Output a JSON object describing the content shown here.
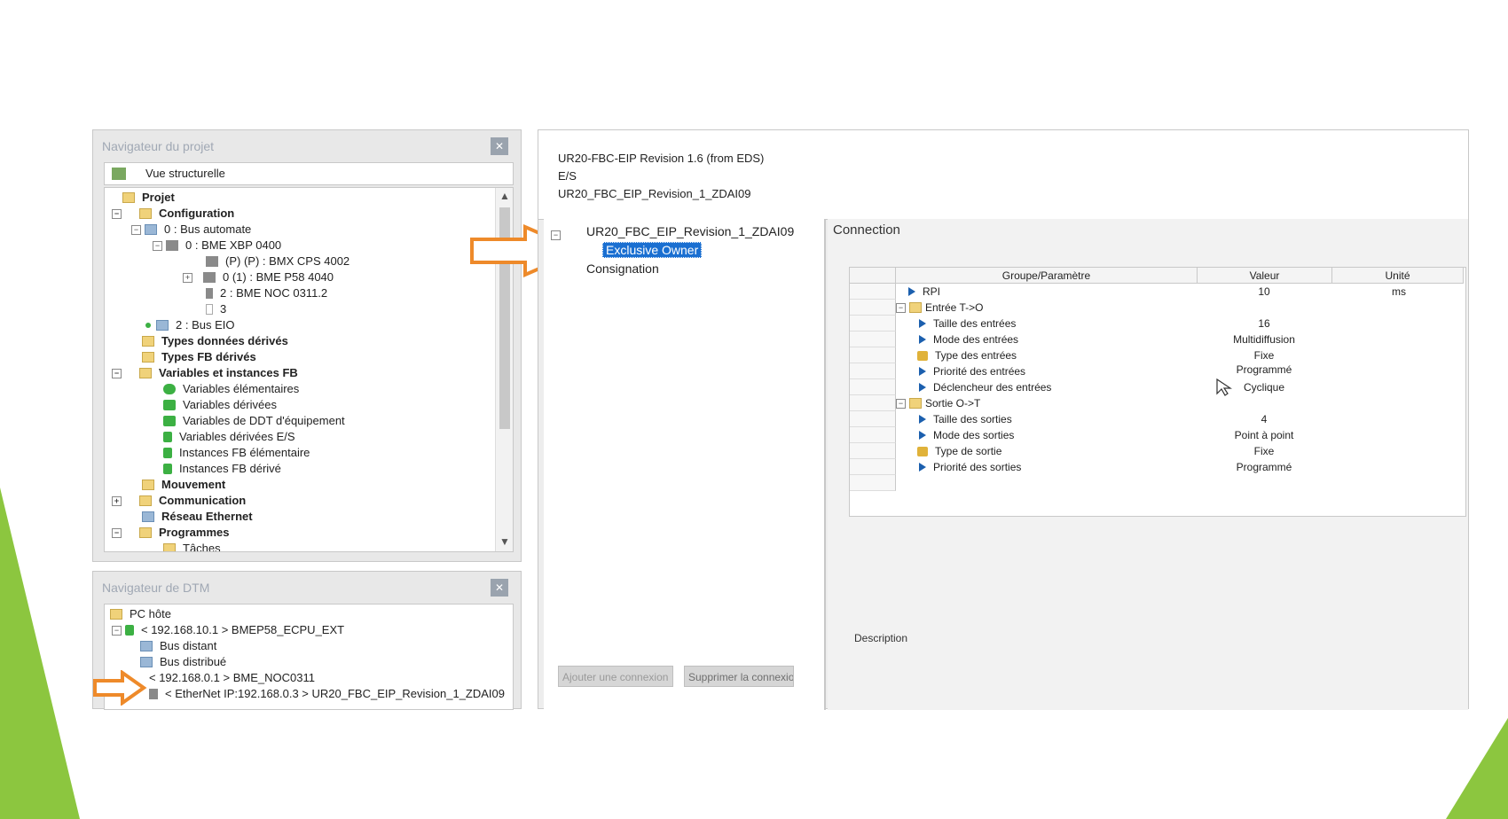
{
  "colors": {
    "accent_green": "#8cc63f",
    "selection_blue": "#1a6fd1",
    "arrow_orange": "#ee8a2a"
  },
  "project_nav": {
    "title": "Navigateur du projet",
    "close_icon": "close-icon",
    "view_label": "Vue structurelle",
    "tree": [
      {
        "label": "Projet"
      },
      {
        "label": "Configuration"
      },
      {
        "label": "0 : Bus automate"
      },
      {
        "label": "0 : BME XBP 0400"
      },
      {
        "label": "(P) (P) : BMX CPS 4002"
      },
      {
        "label": "0 (1) : BME P58 4040"
      },
      {
        "label": "2 : BME NOC 0311.2"
      },
      {
        "label": "3"
      },
      {
        "label": "2 : Bus EIO"
      },
      {
        "label": "Types données dérivés"
      },
      {
        "label": "Types FB dérivés"
      },
      {
        "label": "Variables et instances FB"
      },
      {
        "label": "Variables élémentaires"
      },
      {
        "label": "Variables dérivées"
      },
      {
        "label": "Variables de DDT d'équipement"
      },
      {
        "label": "Variables dérivées E/S"
      },
      {
        "label": "Instances FB élémentaire"
      },
      {
        "label": "Instances FB dérivé"
      },
      {
        "label": "Mouvement"
      },
      {
        "label": "Communication"
      },
      {
        "label": "Réseau Ethernet"
      },
      {
        "label": "Programmes"
      },
      {
        "label": "Tâches"
      }
    ]
  },
  "dtm_nav": {
    "title": "Navigateur de DTM",
    "tree": [
      {
        "label": "PC hôte"
      },
      {
        "label": "< 192.168.10.1 > BMEP58_ECPU_EXT"
      },
      {
        "label": "Bus distant"
      },
      {
        "label": "Bus distribué"
      },
      {
        "label": "< 192.168.0.1 > BME_NOC0311"
      },
      {
        "label": "< EtherNet IP:192.168.0.3 > UR20_FBC_EIP_Revision_1_ZDAI09"
      }
    ]
  },
  "device": {
    "line1": "UR20-FBC-EIP Revision 1.6 (from EDS)",
    "line2": "E/S",
    "line3": "UR20_FBC_EIP_Revision_1_ZDAI09"
  },
  "connections": {
    "root": "UR20_FBC_EIP_Revision_1_ZDAI09",
    "selected": "Exclusive Owner",
    "other": "Consignation",
    "add_button": "Ajouter une connexion",
    "remove_button": "Supprimer la connexion"
  },
  "connection_tab": {
    "tab_label": "Connection",
    "headers": {
      "param": "Groupe/Paramètre",
      "value": "Valeur",
      "unit": "Unité"
    },
    "rows": [
      {
        "label": "RPI",
        "value": "10",
        "unit": "ms"
      },
      {
        "label": "Entrée T->O",
        "value": "",
        "unit": ""
      },
      {
        "label": "Taille des entrées",
        "value": "16",
        "unit": ""
      },
      {
        "label": "Mode des entrées",
        "value": "Multidiffusion",
        "unit": ""
      },
      {
        "label": "Type des entrées",
        "value": "Fixe",
        "unit": ""
      },
      {
        "label": "Priorité des entrées",
        "value": "Programmé",
        "unit": ""
      },
      {
        "label": "Déclencheur des entrées",
        "value": "Cyclique",
        "unit": ""
      },
      {
        "label": "Sortie O->T",
        "value": "",
        "unit": ""
      },
      {
        "label": "Taille des sorties",
        "value": "4",
        "unit": ""
      },
      {
        "label": "Mode des sorties",
        "value": "Point à point",
        "unit": ""
      },
      {
        "label": "Type de sortie",
        "value": "Fixe",
        "unit": ""
      },
      {
        "label": "Priorité des sorties",
        "value": "Programmé",
        "unit": ""
      }
    ],
    "description_label": "Description"
  }
}
